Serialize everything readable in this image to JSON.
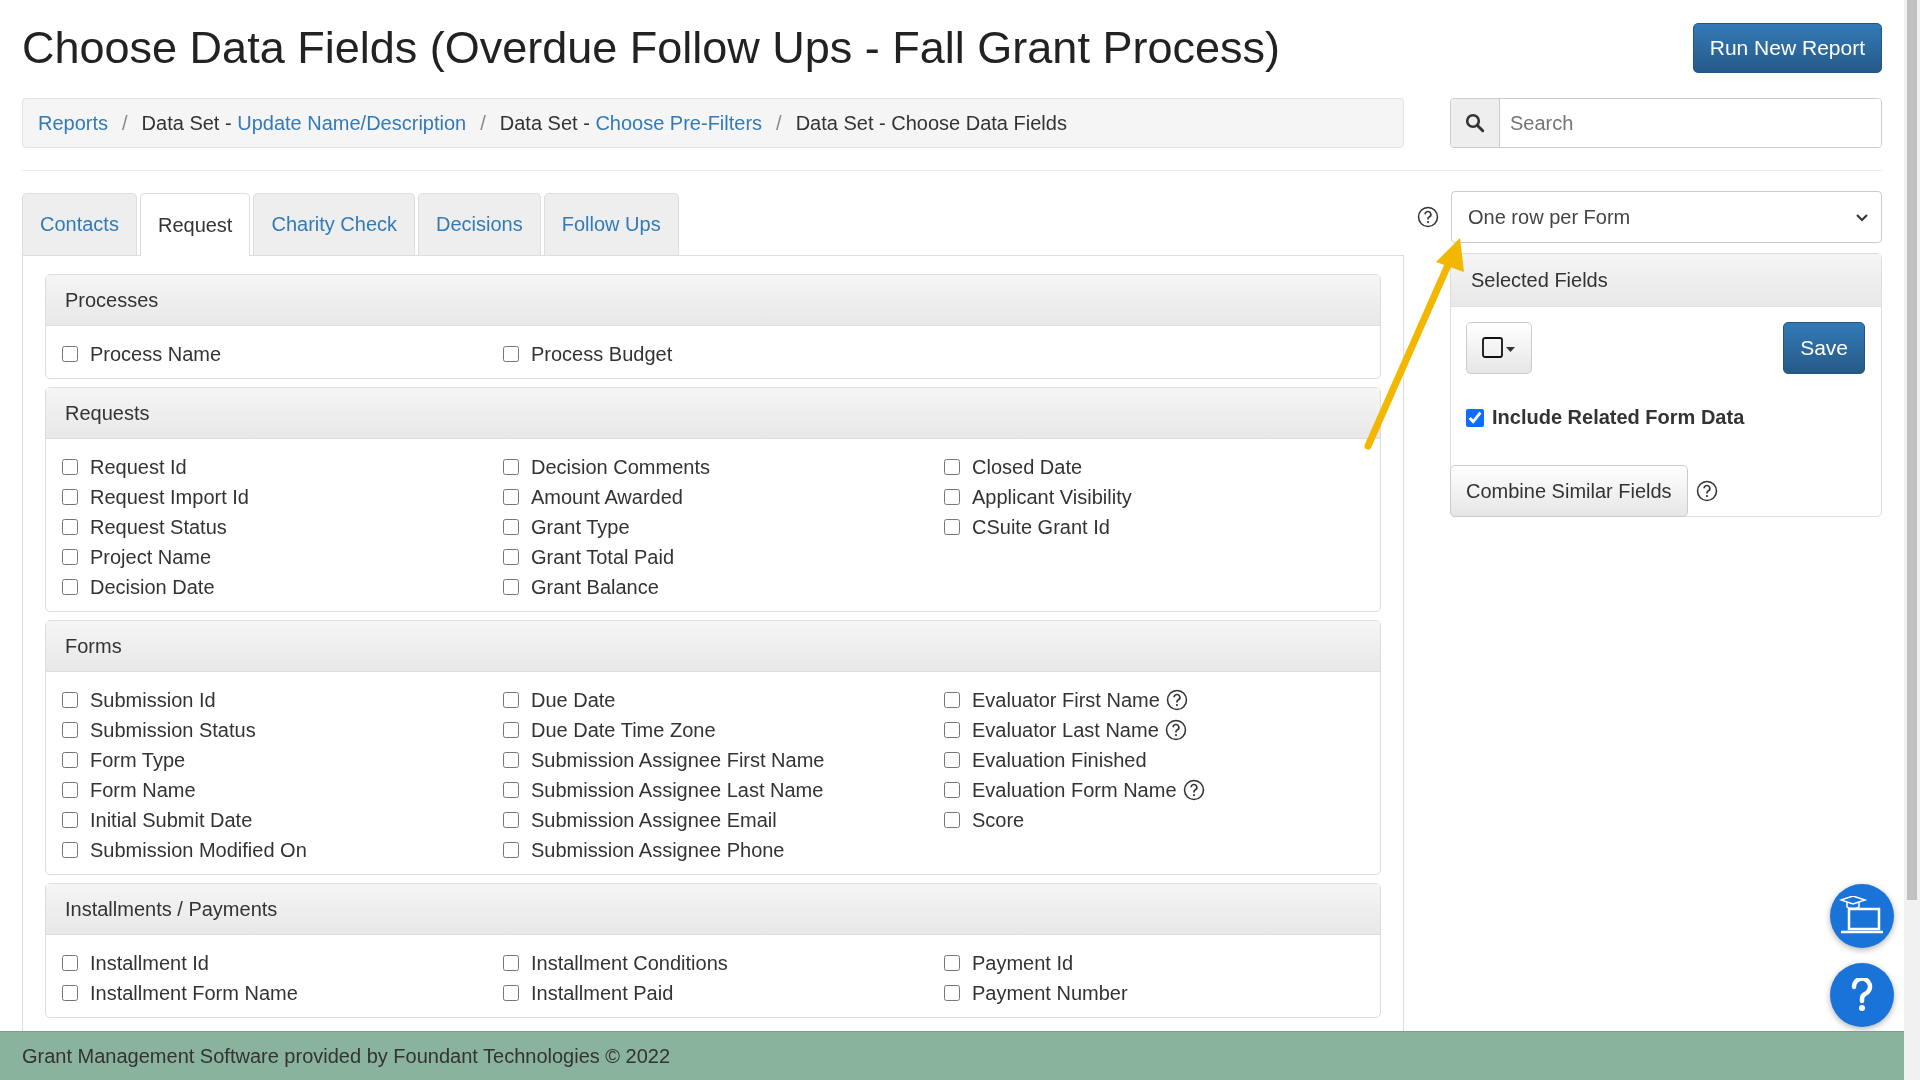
{
  "title": "Choose Data Fields (Overdue Follow Ups - Fall Grant Process)",
  "run_button": "Run New Report",
  "breadcrumb": [
    {
      "kind": "link",
      "text": "Reports"
    },
    {
      "kind": "mixed",
      "separator": "/",
      "prefix": "Data Set - ",
      "text": "Update Name/Description"
    },
    {
      "kind": "mixed",
      "separator": "/",
      "prefix": "Data Set - ",
      "text": "Choose Pre-Filters"
    },
    {
      "kind": "current",
      "separator": "/",
      "text": "Data Set - Choose Data Fields"
    }
  ],
  "search": {
    "placeholder": "Search"
  },
  "tabs": [
    {
      "label": "Contacts",
      "selected": false
    },
    {
      "label": "Request",
      "selected": true
    },
    {
      "label": "Charity Check",
      "selected": false
    },
    {
      "label": "Decisions",
      "selected": false
    },
    {
      "label": "Follow Ups",
      "selected": false
    }
  ],
  "sections": [
    {
      "title": "Processes",
      "columns": [
        [
          {
            "label": "Process Name",
            "checked": false
          }
        ],
        [
          {
            "label": "Process Budget",
            "checked": false
          }
        ],
        []
      ]
    },
    {
      "title": "Requests",
      "columns": [
        [
          {
            "label": "Request Id",
            "checked": false
          },
          {
            "label": "Request Import Id",
            "checked": false
          },
          {
            "label": "Request Status",
            "checked": false
          },
          {
            "label": "Project Name",
            "checked": false
          },
          {
            "label": "Decision Date",
            "checked": false
          }
        ],
        [
          {
            "label": "Decision Comments",
            "checked": false
          },
          {
            "label": "Amount Awarded",
            "checked": false
          },
          {
            "label": "Grant Type",
            "checked": false
          },
          {
            "label": "Grant Total Paid",
            "checked": false
          },
          {
            "label": "Grant Balance",
            "checked": false
          }
        ],
        [
          {
            "label": "Closed Date",
            "checked": false
          },
          {
            "label": "Applicant Visibility",
            "checked": false
          },
          {
            "label": "CSuite Grant Id",
            "checked": false
          }
        ]
      ]
    },
    {
      "title": "Forms",
      "columns": [
        [
          {
            "label": "Submission Id",
            "checked": false
          },
          {
            "label": "Submission Status",
            "checked": false
          },
          {
            "label": "Form Type",
            "checked": false
          },
          {
            "label": "Form Name",
            "checked": false
          },
          {
            "label": "Initial Submit Date",
            "checked": false
          },
          {
            "label": "Submission Modified On",
            "checked": false
          }
        ],
        [
          {
            "label": "Due Date",
            "checked": false
          },
          {
            "label": "Due Date Time Zone",
            "checked": false
          },
          {
            "label": "Submission Assignee First Name",
            "checked": false
          },
          {
            "label": "Submission Assignee Last Name",
            "checked": false
          },
          {
            "label": "Submission Assignee Email",
            "checked": false
          },
          {
            "label": "Submission Assignee Phone",
            "checked": false
          }
        ],
        [
          {
            "label": "Evaluator First Name",
            "checked": false,
            "help": true
          },
          {
            "label": "Evaluator Last Name",
            "checked": false,
            "help": true
          },
          {
            "label": "Evaluation Finished",
            "checked": false
          },
          {
            "label": "Evaluation Form Name",
            "checked": false,
            "help": true
          },
          {
            "label": "Score",
            "checked": false
          }
        ]
      ]
    },
    {
      "title": "Installments / Payments",
      "columns": [
        [
          {
            "label": "Installment Id",
            "checked": false
          },
          {
            "label": "Installment Form Name",
            "checked": false
          }
        ],
        [
          {
            "label": "Installment Conditions",
            "checked": false
          },
          {
            "label": "Installment Paid",
            "checked": false
          }
        ],
        [
          {
            "label": "Payment Id",
            "checked": false
          },
          {
            "label": "Payment Number",
            "checked": false
          }
        ]
      ]
    }
  ],
  "row_mode": {
    "value": "One row per Form"
  },
  "selected_fields": {
    "title": "Selected Fields",
    "save": "Save",
    "include_related": {
      "label": "Include Related Form Data",
      "checked": true
    },
    "combine": "Combine Similar Fields"
  },
  "footer": "Grant Management Software provided by Foundant Technologies © 2022"
}
